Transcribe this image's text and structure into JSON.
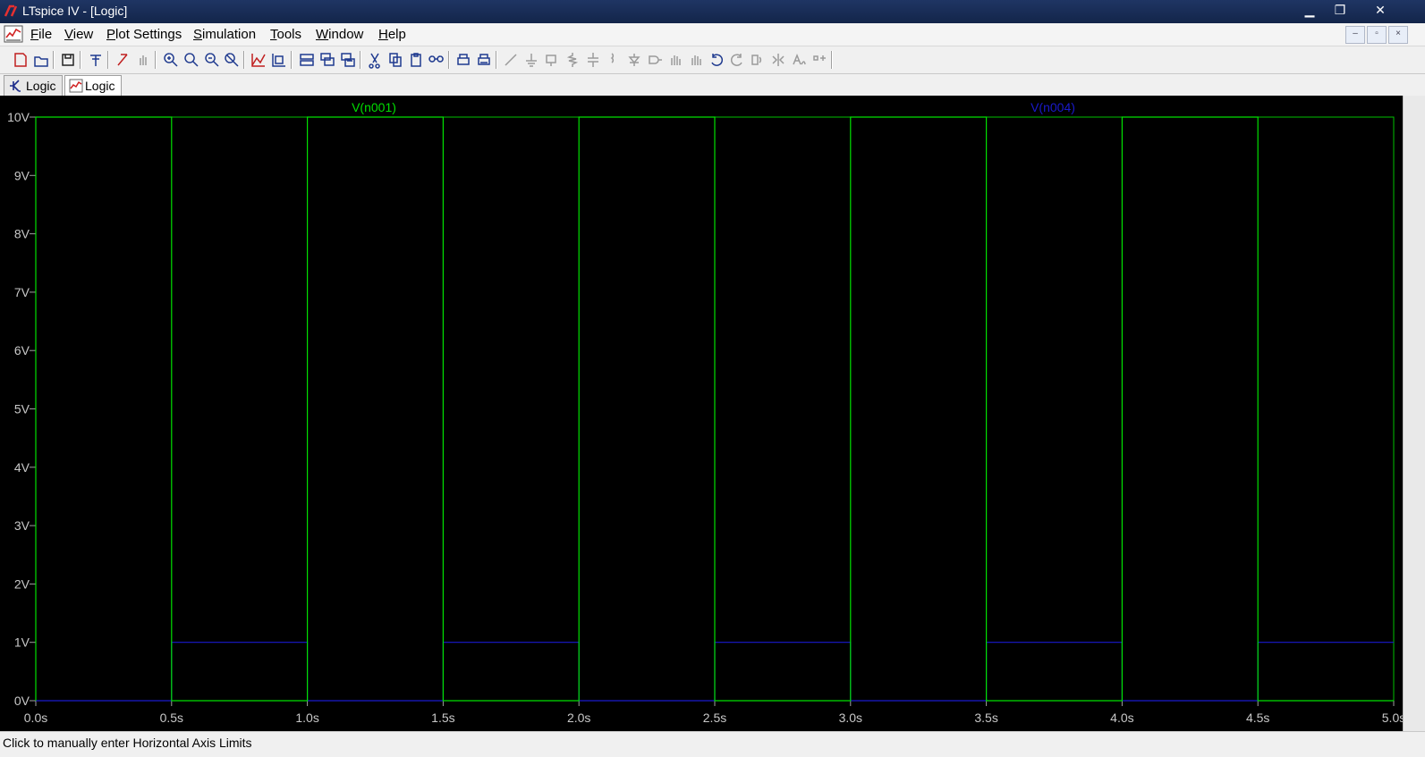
{
  "window": {
    "title": "LTspice IV - [Logic]",
    "min": "▁",
    "max": "❐",
    "close": "✕"
  },
  "menu": [
    {
      "label": "File",
      "ul": "F",
      "rest": "ile"
    },
    {
      "label": "View",
      "ul": "V",
      "rest": "iew"
    },
    {
      "label": "Plot Settings",
      "ul": "P",
      "rest": "lot Settings"
    },
    {
      "label": "Simulation",
      "ul": "S",
      "rest": "imulation"
    },
    {
      "label": "Tools",
      "ul": "T",
      "rest": "ools"
    },
    {
      "label": "Window",
      "ul": "W",
      "rest": "indow"
    },
    {
      "label": "Help",
      "ul": "H",
      "rest": "elp"
    }
  ],
  "mdi_buttons": {
    "min": "–",
    "restore": "▫",
    "close": "×"
  },
  "tabs": [
    {
      "label": "Logic",
      "kind": "schematic"
    },
    {
      "label": "Logic",
      "kind": "waveform"
    }
  ],
  "toolbar_icons": [
    "new-schematic-icon",
    "open-icon",
    "save-icon",
    "control-panel-icon",
    "run-icon",
    "pan-hand-icon",
    "zoom-in-icon",
    "zoom-area-icon",
    "zoom-out-icon",
    "zoom-fit-icon",
    "autorange-icon",
    "mark-icon",
    "tile-horizontal-icon",
    "cascade-icon",
    "tile-vertical-icon",
    "cut-icon",
    "copy-icon",
    "paste-icon",
    "find-icon",
    "print-setup-icon",
    "print-icon",
    "wire-icon",
    "ground-icon",
    "label-icon",
    "resistor-icon",
    "capacitor-icon",
    "inductor-icon",
    "diode-icon",
    "component-icon",
    "move-icon",
    "drag-icon",
    "undo-icon",
    "redo-icon",
    "rotate-icon",
    "mirror-icon",
    "text-icon",
    "spice-directive-icon"
  ],
  "status": "Click to manually enter Horizontal Axis Limits",
  "colors": {
    "v1": "#00e000",
    "v2": "#1a1acd",
    "axis": "#00c000",
    "background": "#000000"
  },
  "chart_data": {
    "type": "line",
    "title": "",
    "xlabel": "",
    "ylabel": "",
    "xlim": [
      0,
      5
    ],
    "ylim": [
      0,
      10
    ],
    "xticks": [
      "0.0s",
      "0.5s",
      "1.0s",
      "1.5s",
      "2.0s",
      "2.5s",
      "3.0s",
      "3.5s",
      "4.0s",
      "4.5s",
      "5.0s"
    ],
    "yticks": [
      "0V",
      "1V",
      "2V",
      "3V",
      "4V",
      "5V",
      "6V",
      "7V",
      "8V",
      "9V",
      "10V"
    ],
    "series": [
      {
        "name": "V(n001)",
        "color": "#00e000",
        "x": [
          0,
          0,
          0.5,
          0.5,
          1.0,
          1.0,
          1.5,
          1.5,
          2.0,
          2.0,
          2.5,
          2.5,
          3.0,
          3.0,
          3.5,
          3.5,
          4.0,
          4.0,
          4.5,
          4.5,
          5.0
        ],
        "y": [
          0,
          10,
          10,
          0,
          0,
          10,
          10,
          0,
          0,
          10,
          10,
          0,
          0,
          10,
          10,
          0,
          0,
          10,
          10,
          0,
          0
        ]
      },
      {
        "name": "V(n004)",
        "color": "#1a1acd",
        "x": [
          0,
          0.5,
          0.5,
          1.0,
          1.0,
          1.5,
          1.5,
          2.0,
          2.0,
          2.5,
          2.5,
          3.0,
          3.0,
          3.5,
          3.5,
          4.0,
          4.0,
          4.5,
          4.5,
          5.0
        ],
        "y": [
          0,
          0,
          1,
          1,
          0,
          0,
          1,
          1,
          0,
          0,
          1,
          1,
          0,
          0,
          1,
          1,
          0,
          0,
          1,
          1
        ]
      }
    ]
  }
}
